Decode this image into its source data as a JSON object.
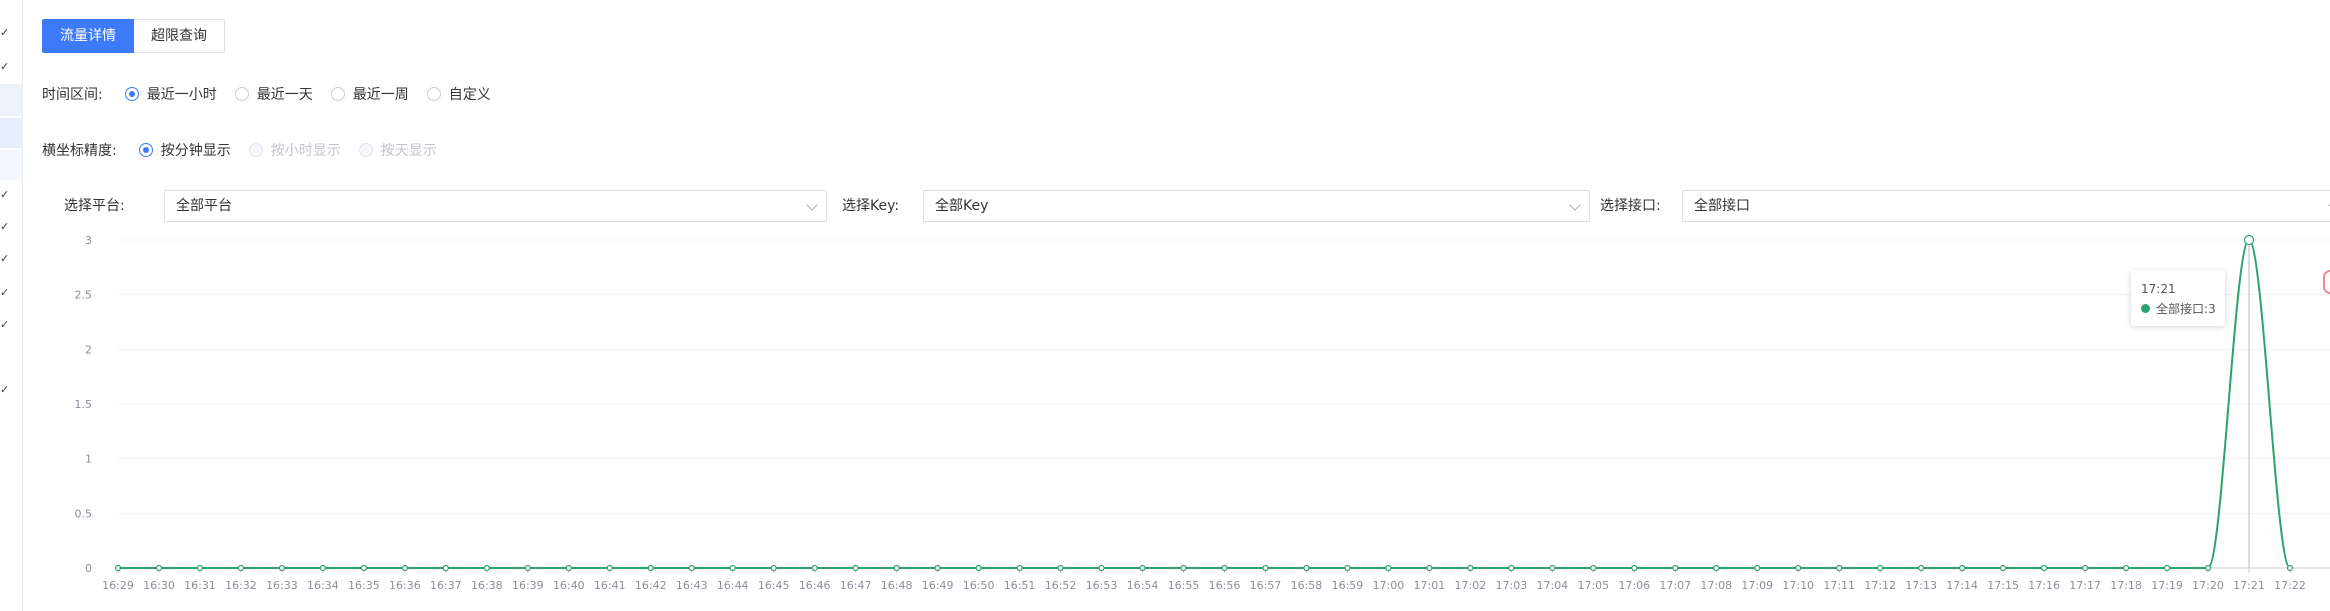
{
  "tabs": [
    {
      "label": "流量详情",
      "active": true
    },
    {
      "label": "超限查询",
      "active": false
    }
  ],
  "time_range": {
    "label": "时间区间:",
    "options": [
      {
        "label": "最近一小时",
        "selected": true,
        "disabled": false
      },
      {
        "label": "最近一天",
        "selected": false,
        "disabled": false
      },
      {
        "label": "最近一周",
        "selected": false,
        "disabled": false
      },
      {
        "label": "自定义",
        "selected": false,
        "disabled": false
      }
    ]
  },
  "precision": {
    "label": "横坐标精度:",
    "options": [
      {
        "label": "按分钟显示",
        "selected": true,
        "disabled": false
      },
      {
        "label": "按小时显示",
        "selected": false,
        "disabled": true
      },
      {
        "label": "按天显示",
        "selected": false,
        "disabled": true
      }
    ]
  },
  "filters": {
    "platform": {
      "label": "选择平台:",
      "value": "全部平台"
    },
    "key": {
      "label": "选择Key:",
      "value": "全部Key"
    },
    "api": {
      "label": "选择接口:",
      "value": "全部接口"
    }
  },
  "tooltip": {
    "title": "17:21",
    "series": "全部接口",
    "value": "3"
  },
  "chart_data": {
    "type": "line",
    "x": [
      "16:29",
      "16:30",
      "16:31",
      "16:32",
      "16:33",
      "16:34",
      "16:35",
      "16:36",
      "16:37",
      "16:38",
      "16:39",
      "16:40",
      "16:41",
      "16:42",
      "16:43",
      "16:44",
      "16:45",
      "16:46",
      "16:47",
      "16:48",
      "16:49",
      "16:50",
      "16:51",
      "16:52",
      "16:53",
      "16:54",
      "16:55",
      "16:56",
      "16:57",
      "16:58",
      "16:59",
      "17:00",
      "17:01",
      "17:02",
      "17:03",
      "17:04",
      "17:05",
      "17:06",
      "17:07",
      "17:08",
      "17:09",
      "17:10",
      "17:11",
      "17:12",
      "17:13",
      "17:14",
      "17:15",
      "17:16",
      "17:17",
      "17:18",
      "17:19",
      "17:20",
      "17:21",
      "17:22"
    ],
    "series": [
      {
        "name": "全部接口",
        "color": "#2ea26d",
        "values": [
          0,
          0,
          0,
          0,
          0,
          0,
          0,
          0,
          0,
          0,
          0,
          0,
          0,
          0,
          0,
          0,
          0,
          0,
          0,
          0,
          0,
          0,
          0,
          0,
          0,
          0,
          0,
          0,
          0,
          0,
          0,
          0,
          0,
          0,
          0,
          0,
          0,
          0,
          0,
          0,
          0,
          0,
          0,
          0,
          0,
          0,
          0,
          0,
          0,
          0,
          0,
          0,
          3,
          0
        ]
      }
    ],
    "yticks": [
      "0",
      "0.5",
      "1",
      "1.5",
      "2",
      "2.5",
      "3"
    ],
    "ylim": [
      0,
      3
    ],
    "grid": true,
    "highlight_index": 52
  },
  "colors": {
    "primary": "#3d7af7",
    "series": "#2ea26d"
  }
}
